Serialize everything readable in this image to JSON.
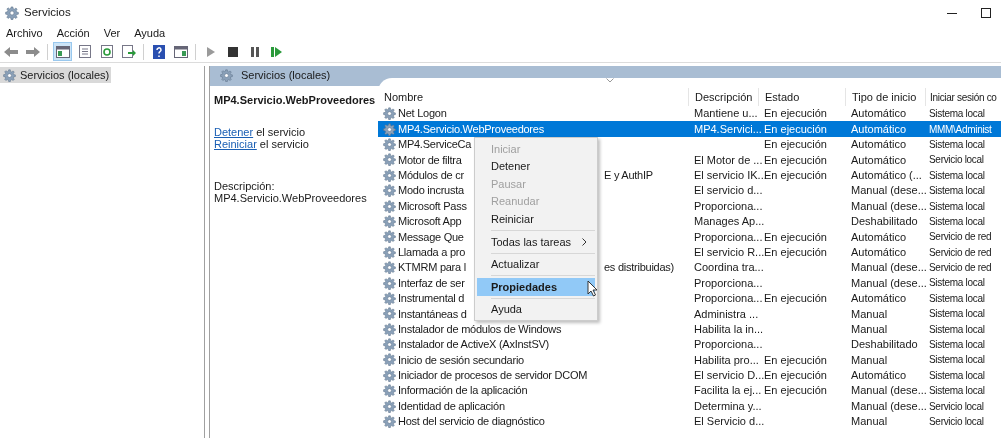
{
  "window": {
    "title": "Servicios"
  },
  "menu": [
    "Archivo",
    "Acción",
    "Ver",
    "Ayuda"
  ],
  "toolbar": [
    {
      "kind": "back",
      "pressed": false
    },
    {
      "kind": "forward",
      "pressed": false
    },
    {
      "kind": "separator"
    },
    {
      "kind": "tree",
      "pressed": true
    },
    {
      "kind": "sheet",
      "pressed": false
    },
    {
      "kind": "refresh",
      "pressed": false
    },
    {
      "kind": "export",
      "pressed": false
    },
    {
      "kind": "separator"
    },
    {
      "kind": "help",
      "pressed": false
    },
    {
      "kind": "view",
      "pressed": false
    },
    {
      "kind": "separator"
    },
    {
      "kind": "play",
      "pressed": false
    },
    {
      "kind": "stop",
      "pressed": false
    },
    {
      "kind": "pause",
      "pressed": false
    },
    {
      "kind": "restart",
      "pressed": false
    }
  ],
  "tree": [
    {
      "label": "Servicios (locales)",
      "selected": true
    }
  ],
  "pane_header": "Servicios (locales)",
  "details": {
    "title": "MP4.Servicio.WebProveedores",
    "actions": [
      {
        "link": "Detener",
        "text": "el servicio"
      },
      {
        "link": "Reiniciar",
        "text": "el servicio"
      }
    ],
    "description_label": "Descripción:",
    "description": "MP4.Servicio.WebProveedores"
  },
  "table": {
    "columns": [
      "Nombre",
      "Descripción",
      "Estado",
      "Tipo de inicio",
      "Iniciar sesión co"
    ],
    "rows": [
      {
        "name": "Net Logon",
        "description": "Mantiene u...",
        "status": "En ejecución",
        "startup": "Automático",
        "logon": "Sistema local",
        "selected": false
      },
      {
        "name": "MP4.Servicio.WebProveedores",
        "description": "MP4.Servici...",
        "status": "En ejecución",
        "startup": "Automático",
        "logon": "MMM\\Administ",
        "selected": true
      },
      {
        "name": "MP4.ServiceCa",
        "status": "En ejecución",
        "startup": "Automático",
        "logon": "Sistema local",
        "selected": false
      },
      {
        "name": "Motor de filtra",
        "description": "El Motor de ...",
        "status": "En ejecución",
        "startup": "Automático",
        "logon": "Servicio local",
        "selected": false
      },
      {
        "name": "Módulos de cr",
        "name_end": "E y AuthIP",
        "description": "El servicio IK...",
        "status": "En ejecución",
        "startup": "Automático (...",
        "logon": "Sistema local",
        "selected": false
      },
      {
        "name": "Modo incrusta",
        "description": "El servicio d...",
        "startup": "Manual (dese...",
        "logon": "Sistema local",
        "selected": false
      },
      {
        "name": "Microsoft Pass",
        "description": "Proporciona...",
        "startup": "Manual (dese...",
        "logon": "Sistema local",
        "selected": false
      },
      {
        "name": "Microsoft App",
        "description": "Manages Ap...",
        "startup": "Deshabilitado",
        "logon": "Sistema local",
        "selected": false
      },
      {
        "name": "Message Que",
        "description": "Proporciona...",
        "status": "En ejecución",
        "startup": "Automático",
        "logon": "Servicio de red",
        "selected": false
      },
      {
        "name": "Llamada a pro",
        "description": "El servicio R...",
        "status": "En ejecución",
        "startup": "Automático",
        "logon": "Servicio de red",
        "selected": false
      },
      {
        "name": "KTMRM para l",
        "name_end": "es distribuidas)",
        "description": "Coordina tra...",
        "startup": "Manual (dese...",
        "logon": "Servicio de red",
        "selected": false
      },
      {
        "name": "Interfaz de ser",
        "description": "Proporciona...",
        "startup": "Manual (dese...",
        "logon": "Sistema local",
        "selected": false
      },
      {
        "name": "Instrumental d",
        "description": "Proporciona...",
        "status": "En ejecución",
        "startup": "Automático",
        "logon": "Sistema local",
        "selected": false
      },
      {
        "name": "Instantáneas d",
        "description": "Administra ...",
        "startup": "Manual",
        "logon": "Sistema local",
        "selected": false
      },
      {
        "name": "Instalador de módulos de Windows",
        "description": "Habilita la in...",
        "startup": "Manual",
        "logon": "Sistema local",
        "selected": false
      },
      {
        "name": "Instalador de ActiveX (AxInstSV)",
        "description": "Proporciona...",
        "startup": "Deshabilitado",
        "logon": "Sistema local",
        "selected": false
      },
      {
        "name": "Inicio de sesión secundario",
        "description": "Habilita pro...",
        "status": "En ejecución",
        "startup": "Manual",
        "logon": "Sistema local",
        "selected": false
      },
      {
        "name": "Iniciador de procesos de servidor DCOM",
        "description": "El servicio D...",
        "status": "En ejecución",
        "startup": "Automático",
        "logon": "Sistema local",
        "selected": false
      },
      {
        "name": "Información de la aplicación",
        "description": "Facilita la ej...",
        "status": "En ejecución",
        "startup": "Manual (dese...",
        "logon": "Sistema local",
        "selected": false
      },
      {
        "name": "Identidad de aplicación",
        "description": "Determina y...",
        "startup": "Manual (dese...",
        "logon": "Servicio local",
        "selected": false
      },
      {
        "name": "Host del servicio de diagnóstico",
        "description": "El Servicio d...",
        "startup": "Manual",
        "logon": "Servicio local",
        "selected": false
      }
    ]
  },
  "context_menu": [
    {
      "kind": "item",
      "label": "Iniciar",
      "disabled": true,
      "selected": false,
      "submenu": false
    },
    {
      "kind": "item",
      "label": "Detener",
      "disabled": false,
      "selected": false,
      "submenu": false
    },
    {
      "kind": "item",
      "label": "Pausar",
      "disabled": true,
      "selected": false,
      "submenu": false
    },
    {
      "kind": "item",
      "label": "Reanudar",
      "disabled": true,
      "selected": false,
      "submenu": false
    },
    {
      "kind": "item",
      "label": "Reiniciar",
      "disabled": false,
      "selected": false,
      "submenu": false
    },
    {
      "kind": "separator"
    },
    {
      "kind": "item",
      "label": "Todas las tareas",
      "disabled": false,
      "selected": false,
      "submenu": true
    },
    {
      "kind": "separator"
    },
    {
      "kind": "item",
      "label": "Actualizar",
      "disabled": false,
      "selected": false,
      "submenu": false
    },
    {
      "kind": "separator"
    },
    {
      "kind": "item",
      "label": "Propiedades",
      "disabled": false,
      "selected": true,
      "submenu": false
    },
    {
      "kind": "separator"
    },
    {
      "kind": "item",
      "label": "Ayuda",
      "disabled": false,
      "selected": false,
      "submenu": false
    }
  ]
}
